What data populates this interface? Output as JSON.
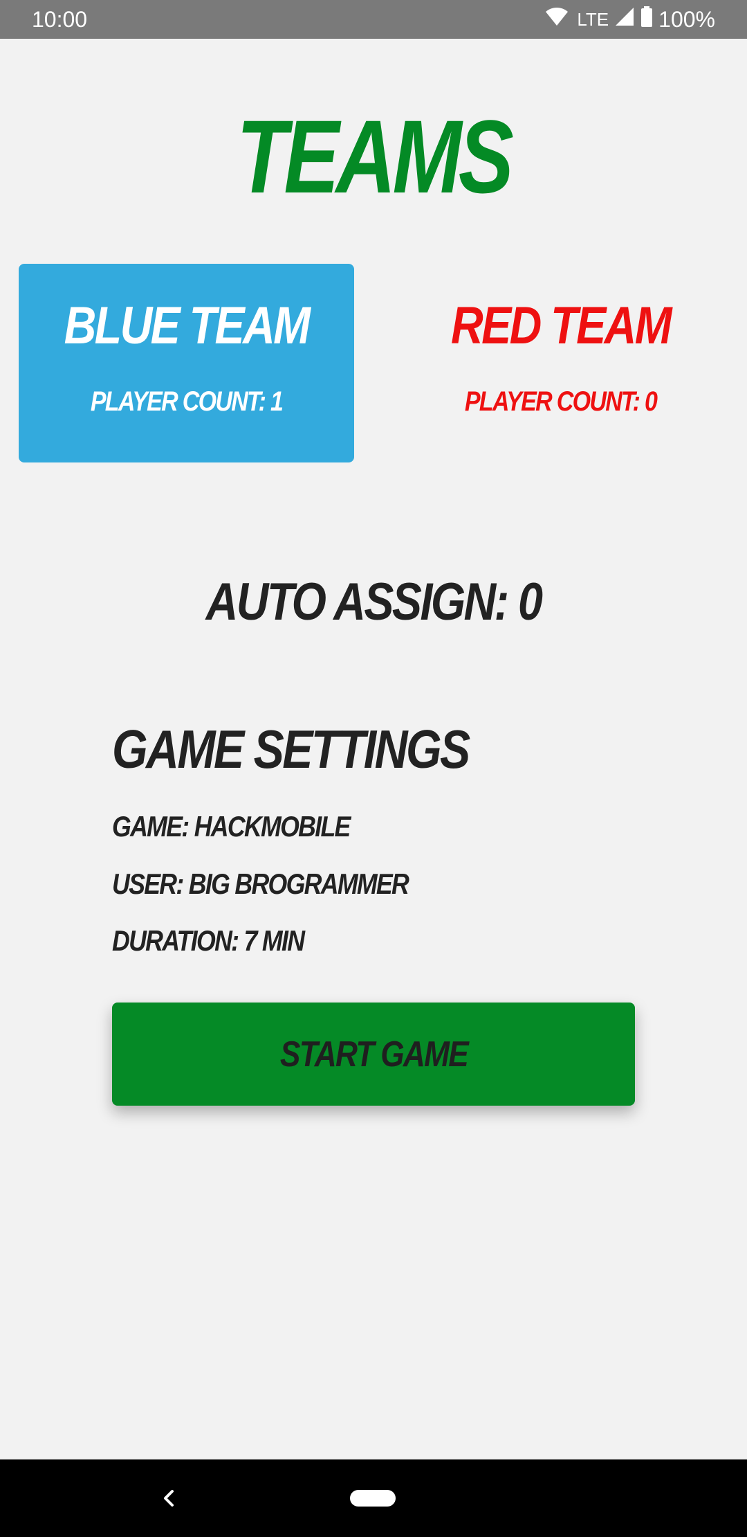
{
  "status_bar": {
    "time": "10:00",
    "network": "LTE",
    "battery": "100%",
    "icons": [
      "wifi-icon",
      "cell-signal-icon",
      "battery-icon"
    ]
  },
  "title": "TEAMS",
  "teams": [
    {
      "name": "BLUE TEAM",
      "count_text": "PLAYER COUNT: 1",
      "selected": true
    },
    {
      "name": "RED TEAM",
      "count_text": "PLAYER COUNT: 0",
      "selected": false
    }
  ],
  "auto_assign": "AUTO ASSIGN: 0",
  "settings": {
    "heading": "GAME SETTINGS",
    "game": "GAME: HACKMOBILE",
    "user": "USER: BIG BROGRAMMER",
    "duration": "DURATION: 7 MIN"
  },
  "start_button": {
    "label": "START GAME"
  },
  "nav": {
    "icons": [
      "back-icon",
      "home-pill-icon"
    ]
  },
  "colors": {
    "title_green": "#048a25",
    "blue_team": "#33aadd",
    "red_team": "#ee1111",
    "button_green": "#058a26",
    "background": "#f2f2f2",
    "text_dark": "#222222"
  }
}
